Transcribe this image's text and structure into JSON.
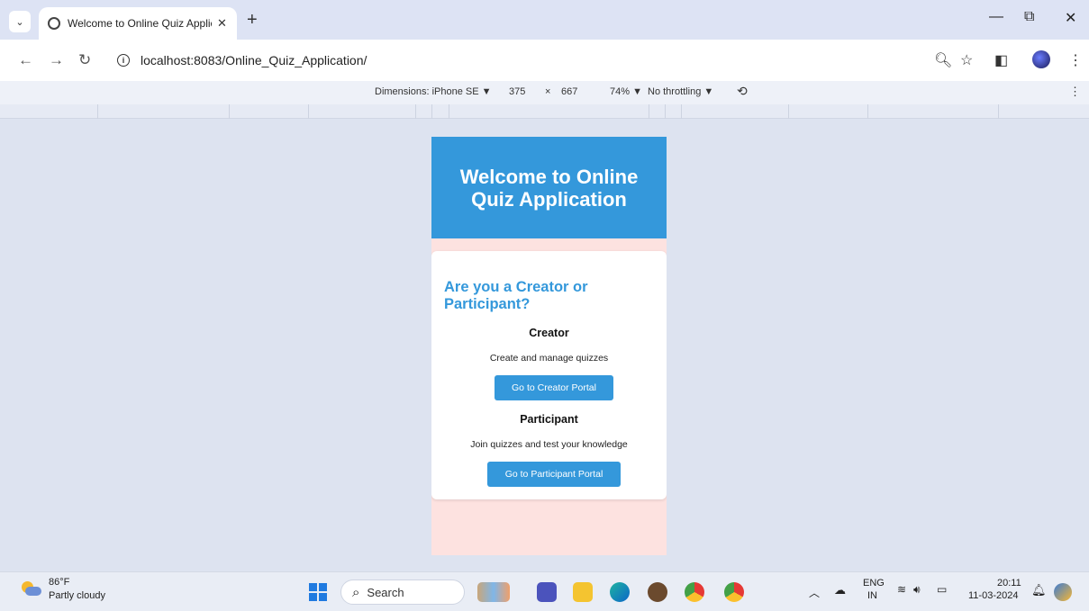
{
  "browser": {
    "tab_title": "Welcome to Online Quiz Applic",
    "url": "localhost:8083/Online_Quiz_Application/"
  },
  "devtools": {
    "device_label": "Dimensions: iPhone SE ▼",
    "width": "375",
    "times": "×",
    "height": "667",
    "zoom": "74% ▼",
    "throttling": "No throttling ▼"
  },
  "app": {
    "title": "Welcome to Online Quiz Application",
    "question": "Are you a Creator or Participant?",
    "creator": {
      "title": "Creator",
      "description": "Create and manage quizzes",
      "button": "Go to Creator Portal"
    },
    "participant": {
      "title": "Participant",
      "description": "Join quizzes and test your knowledge",
      "button": "Go to Participant Portal"
    },
    "colors": {
      "primary": "#3498db",
      "background": "#fde2e0"
    }
  },
  "taskbar": {
    "temperature": "86°F",
    "condition": "Partly cloudy",
    "search_label": "Search",
    "language": "ENG",
    "region": "IN",
    "time": "20:11",
    "date": "11-03-2024"
  }
}
